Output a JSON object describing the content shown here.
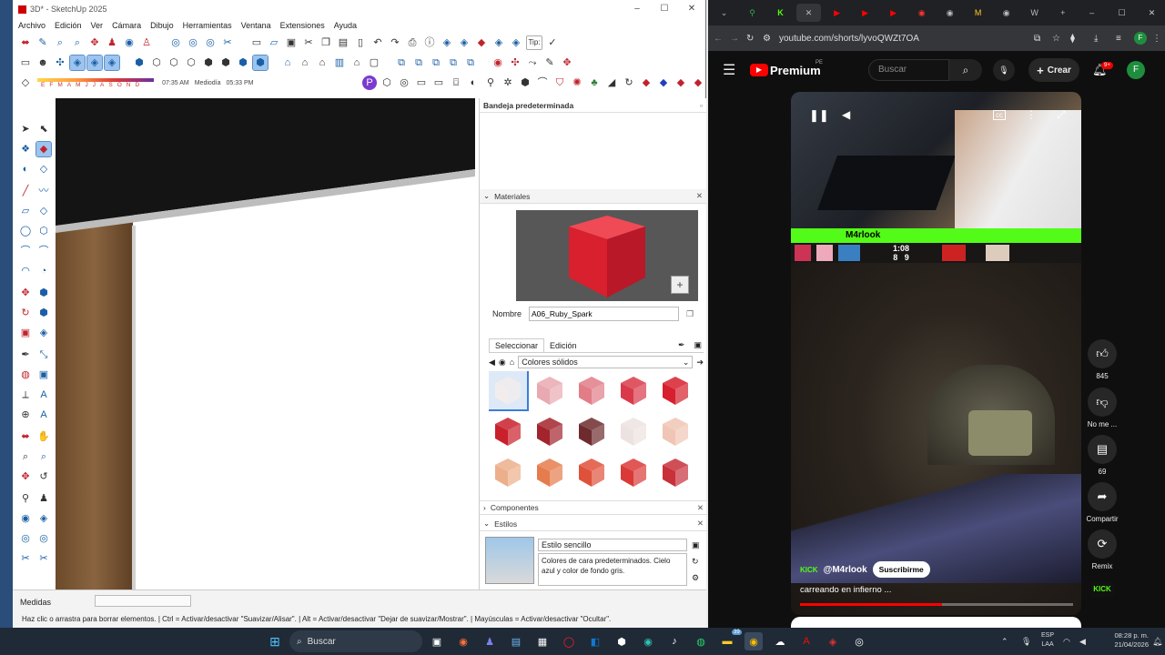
{
  "sketchup": {
    "title": "3D* - SketchUp 2025",
    "menu": [
      "Archivo",
      "Edición",
      "Ver",
      "Cámara",
      "Dibujo",
      "Herramientas",
      "Ventana",
      "Extensiones",
      "Ayuda"
    ],
    "tip_label": "Tip:",
    "months": [
      "E",
      "F",
      "M",
      "A",
      "M",
      "J",
      "J",
      "A",
      "S",
      "O",
      "N",
      "D"
    ],
    "time_start": "07:35 AM",
    "time_mid": "Mediodía",
    "time_end": "05:33 PM",
    "status_label": "Medidas",
    "status_hint": "Haz clic o arrastra para borrar elementos. | Ctrl = Activar/desactivar \"Suavizar/Alisar\". | Alt = Activar/desactivar \"Dejar de suavizar/Mostrar\". | Mayúsculas = Activar/desactivar \"Ocultar\"."
  },
  "tray": {
    "title": "Bandeja predeterminada",
    "materials_header": "Materiales",
    "name_label": "Nombre",
    "name_value": "A06_Ruby_Spark",
    "tab_select": "Seleccionar",
    "tab_edit": "Edición",
    "category": "Colores sólidos",
    "swatch_colors": [
      "#f3ecec",
      "#e9a9b0",
      "#e27c87",
      "#d9394a",
      "#d6202e",
      "#c9202b",
      "#a3242d",
      "#6e2b2d",
      "#ece3e1",
      "#f0c5b5",
      "#ecaf8c",
      "#e57c4d",
      "#e0513b",
      "#da3a37",
      "#c8303a"
    ],
    "components_header": "Componentes",
    "styles_header": "Estilos",
    "style_name": "Estilo sencillo",
    "style_desc": "Colores de cara predeterminados. Cielo azul y color de fondo gris."
  },
  "browser": {
    "url": "youtube.com/shorts/lyvoQWZt7OA",
    "profile_initial": "F"
  },
  "youtube": {
    "brand": "Premium",
    "brand_sup": "PE",
    "search_placeholder": "Buscar",
    "create_label": "Crear",
    "notif_badge": "9+",
    "avatar_initial": "F",
    "like_count": "845",
    "dislike_label": "No me ...",
    "comments_count": "69",
    "share_label": "Compartir",
    "remix_label": "Remix",
    "channel": "@M4rlook",
    "subscribe_label": "Suscribirme",
    "video_title": "carreando en infierno ...",
    "kick_label": "KICK",
    "overlay_timer": "1:08",
    "overlay_score_a": "8",
    "overlay_score_b": "9",
    "overlay_stream_text": "M4rlook",
    "cc_label": "cc"
  },
  "taskbar": {
    "search_label": "Buscar",
    "lang_top": "ESP",
    "lang_bottom": "LAA",
    "time": "08:28 p. m.",
    "date": "21/04/2026",
    "badge": "39"
  }
}
